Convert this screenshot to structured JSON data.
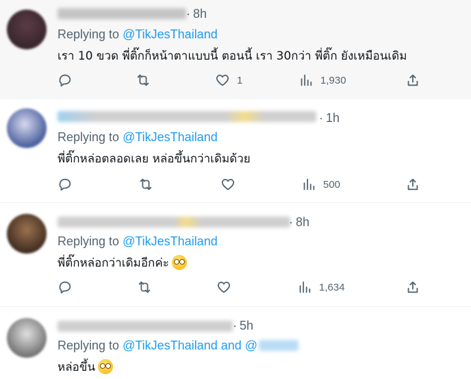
{
  "tweets": [
    {
      "time": "8h",
      "reply_prefix": "Replying to ",
      "mention": "@TikJesThailand",
      "mention_suffix": "",
      "text": "เรา 10 ขวด พี่ติ๊กก็หน้าตาแบบนี้ ตอนนี้ เรา 30กว่า พี่ติ๊ก ยังเหมือนเดิม",
      "likes": "1",
      "views": "1,930",
      "avatar_color": "#3a2a30",
      "highlighted": true
    },
    {
      "time": "1h",
      "reply_prefix": "Replying to ",
      "mention": "@TikJesThailand",
      "mention_suffix": "",
      "text": "พี่ติ๊กหล่อตลอดเลย หล่อขึ้นกว่าเดิมด้วย",
      "likes": "",
      "views": "500",
      "avatar_color": "#6b7fb8",
      "highlighted": false
    },
    {
      "time": "8h",
      "reply_prefix": "Replying to ",
      "mention": "@TikJesThailand",
      "mention_suffix": "",
      "text": "พี่ติ๊กหล่อกว่าเดิมอีกค่ะ",
      "likes": "",
      "views": "1,634",
      "avatar_color": "#6b4a33",
      "highlighted": false
    },
    {
      "time": "5h",
      "reply_prefix": "Replying to ",
      "mention": "@TikJesThailand",
      "mention_suffix": " and @",
      "text": "หล่อขึ้น",
      "likes": "",
      "views": "",
      "avatar_color": "#8a8a8a",
      "highlighted": false
    }
  ],
  "icons": {
    "reply": "reply-icon",
    "retweet": "retweet-icon",
    "like": "heart-icon",
    "views": "views-icon",
    "share": "share-icon",
    "emoji": "smiling-face-with-heart-eyes-emoji"
  },
  "colors": {
    "mention": "#1d9bf0",
    "muted": "#536471",
    "highlight_bg": "#f7f7f7"
  }
}
